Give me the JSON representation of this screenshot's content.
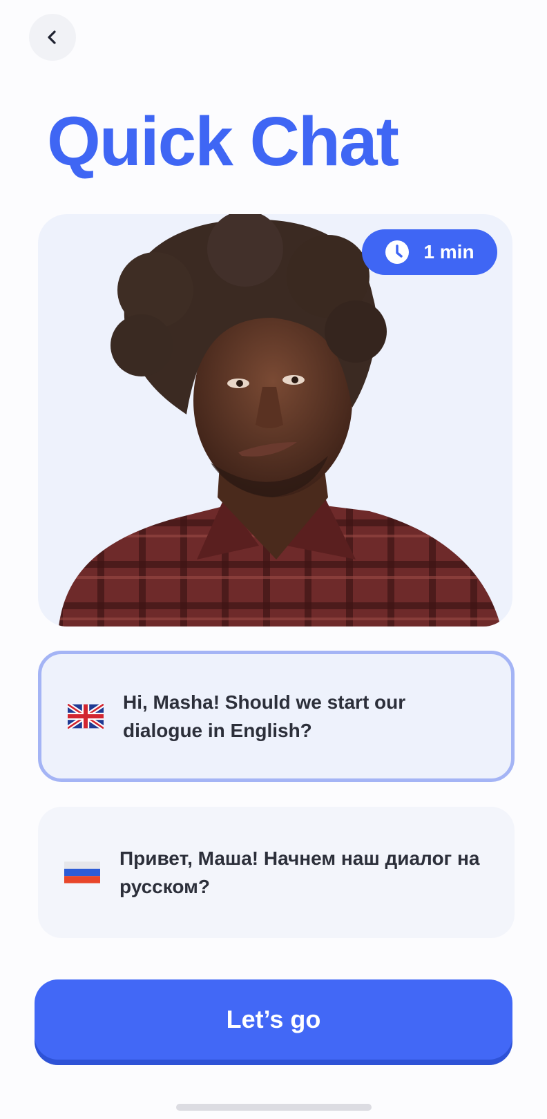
{
  "header": {
    "back_icon": "chevron-left-icon",
    "title": "Quick Chat"
  },
  "hero": {
    "avatar": "character-portrait",
    "timer_icon": "clock-icon",
    "duration": "1 min"
  },
  "options": [
    {
      "flag": "uk-flag-icon",
      "text": "Hi, Masha! Should we start our dialogue in English?",
      "selected": true
    },
    {
      "flag": "russia-flag-icon",
      "text": "Привет, Маша! Начнем наш диалог на русском?",
      "selected": false
    }
  ],
  "cta": {
    "label": "Let’s go"
  },
  "colors": {
    "accent": "#3f66f4",
    "selected_border": "#a4b4f5",
    "card_bg": "#eef2fc",
    "text": "#2c2f3a"
  }
}
